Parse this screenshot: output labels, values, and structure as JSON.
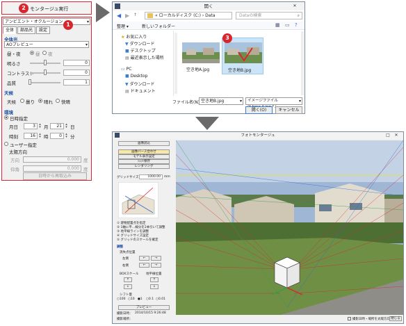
{
  "badges": {
    "b1": "1",
    "b2": "2",
    "b3": "3"
  },
  "left_panel": {
    "montage_button": "モンタージュ実行",
    "mode_combo": "アンビエント・オクルージョン",
    "tabs": [
      "全体",
      "部品光",
      "設定"
    ],
    "zentai_header": "全体光",
    "preview_combo": "AOプレビュー",
    "day_night_label": "昼・夜",
    "day": "昼",
    "night": "夜",
    "brightness_label": "明るさ",
    "brightness_value": "0",
    "contrast_label": "コントラスト",
    "contrast_value": "0",
    "quality_label": "品質",
    "quality_value": "1",
    "weather_header": "天候",
    "weather_label": "天候",
    "cloudy": "曇り",
    "sunny": "晴れ",
    "fine": "快晴",
    "env_header": "環境",
    "datetime_label": "日時指定",
    "month_day_label": "月日",
    "month_value": "3",
    "month_unit": "月",
    "day_value": "21",
    "day_unit": "日",
    "time_label": "時刻",
    "hour_value": "16",
    "hour_unit": "時",
    "min_value": "0",
    "min_unit": "分",
    "user_label": "ユーザー指定",
    "sun_dir_label": "太陽方向",
    "direction_label": "方向",
    "direction_value": "0.000",
    "elevation_label": "仰角",
    "elevation_value": "0.000",
    "deg_unit": "度",
    "recalc_button": "日時から再取込み"
  },
  "open_dialog": {
    "title": "開く",
    "address": "« ローカルディスク (C:) › Data",
    "search_placeholder": "Dataの検索",
    "organize": "整理 ▾",
    "new_folder": "新しいフォルダー",
    "tree": [
      "お気に入り",
      "ダウンロード",
      "デスクトップ",
      "最近表示した場所",
      "PC",
      "Desktop",
      "ダウンロード",
      "ドキュメント"
    ],
    "files": [
      "空き地A.jpg",
      "空き地B.jpg"
    ],
    "filename_label": "ファイル名(N):",
    "filename_value": "空き地B.jpg",
    "filetype_value": "イメージファイル(*.bmp,*.jpg,*.j",
    "open_button": "開く(O)",
    "cancel_button": "キャンセル"
  },
  "photomontage": {
    "title": "フォトモンタージュ",
    "side_buttons": [
      "画像読込",
      "画像パース合わせ",
      "モデル表示設定",
      "ｼｮｯﾄ保存",
      "レンダリング"
    ],
    "grid_size_label": "グリッドサイズ",
    "grid_size_value": "1000.00",
    "grid_size_unit": "mm",
    "steps": [
      "① 建物配置点を指定",
      "② 1軸に平…線分を2本引いて調整",
      "③ 地平線ラインを調整",
      "④ グリッドサイズ設定",
      "⑤ グリッドのスケールを確定"
    ],
    "adjust_header": "調整",
    "vanish_label": "消失点位置",
    "label_left": "左側",
    "label_right": "右側",
    "box_scale_label": "BOXスケール",
    "horizon_label": "地平線位置",
    "shift_label": "シフト量",
    "shift_options": [
      "○100",
      "○10",
      "●1",
      "○0.1",
      "○0.01"
    ],
    "preview_button": "プレビュー",
    "shot_date_label": "撮影日時：",
    "shot_date_value": "2014/10/15 9:26:48",
    "shot_place_label": "撮影場所：",
    "status_check": "撮影日時・場所を太陽方向に反映",
    "close_button": "閉じる"
  },
  "colors": {
    "accent_red": "#d9262e",
    "folder_yellow": "#e8c25a",
    "sky": "#9fb7d4"
  }
}
